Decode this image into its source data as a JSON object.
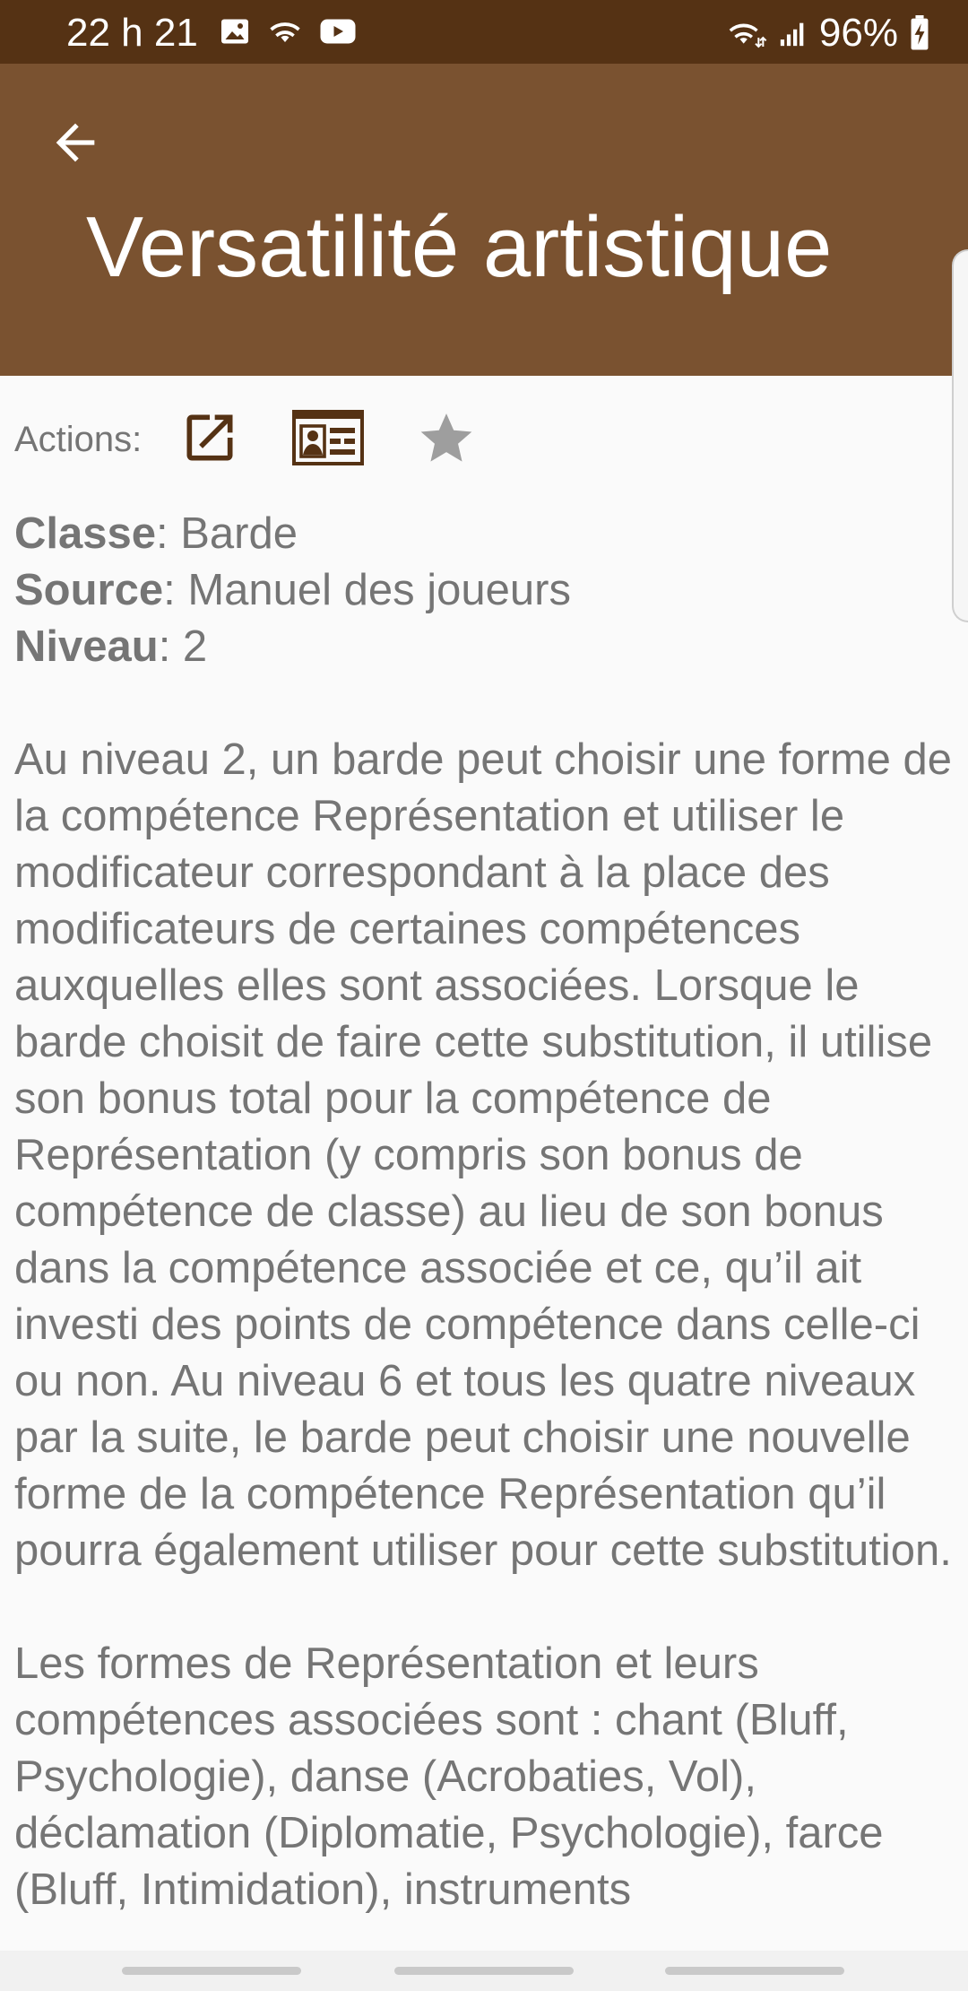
{
  "status_bar": {
    "time": "22 h 21",
    "battery": "96%",
    "left_icons": [
      "image-icon",
      "wifi-icon",
      "youtube-icon"
    ],
    "right_icons": [
      "wifi-calling-icon",
      "signal-icon",
      "battery-charging-icon"
    ]
  },
  "app_bar": {
    "title": "Versatilité artistique",
    "back_icon": "arrow-back-icon",
    "color": "#7a5230"
  },
  "actions": {
    "label": "Actions:",
    "icons": [
      "open-external-icon",
      "character-card-icon",
      "star-icon"
    ]
  },
  "meta": {
    "class_label": "Classe",
    "class_value": ": Barde",
    "source_label": "Source",
    "source_value": ": Manuel des joueurs",
    "level_label": "Niveau",
    "level_value": ": 2"
  },
  "body": {
    "paragraph1": "Au niveau 2, un barde peut choisir une forme de la compétence Représentation et utiliser le modificateur correspondant à la place des modificateurs de certaines compétences auxquelles elles sont associées. Lorsque le barde choisit de faire cette substitution, il utilise son bonus total pour la compétence de Représentation (y compris son bonus de compétence de classe) au lieu de son bonus dans la compétence associée et ce, qu’il ait investi des points de compétence dans celle-ci ou non. Au niveau 6 et tous les quatre niveaux par la suite, le barde peut choisir une nouvelle forme de la compétence Représentation qu’il pourra également utiliser pour cette substitution.",
    "paragraph2": "Les formes de Représentation et leurs compétences associées sont : chant (Bluff, Psychologie), danse (Acrobaties, Vol), déclamation (Diplomatie, Psychologie), farce (Bluff, Intimidation), instruments"
  },
  "colors": {
    "status_bar": "#553214",
    "app_bar": "#7a5230",
    "action_icon": "#553214",
    "star": "#9e9e9e",
    "text": "#757575"
  }
}
